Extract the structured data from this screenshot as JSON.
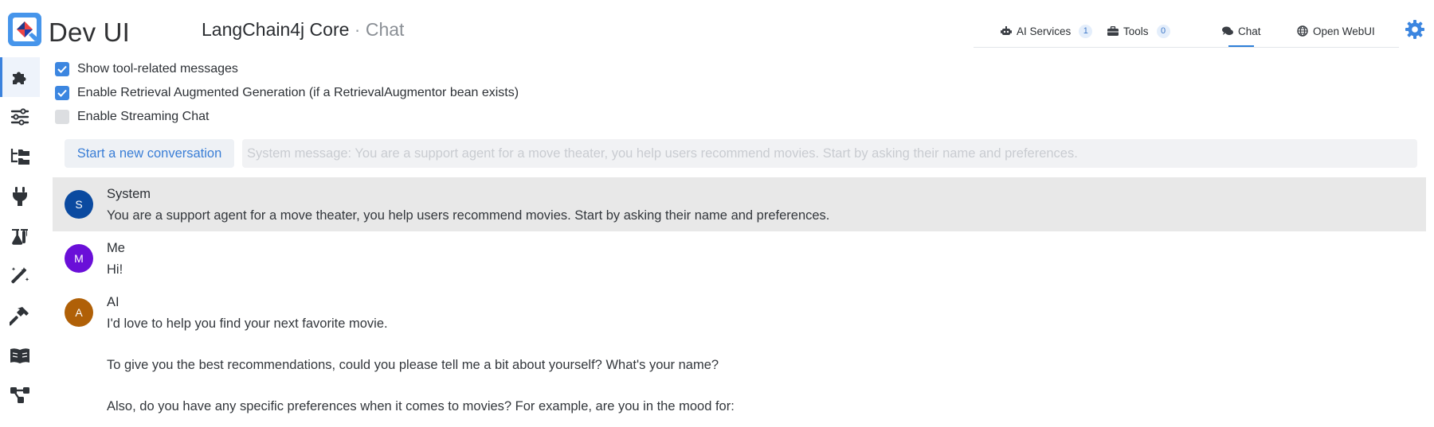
{
  "app": {
    "title": "Dev UI"
  },
  "extension": {
    "name": "LangChain4j Core",
    "separator": "·",
    "page": "Chat"
  },
  "tabs": [
    {
      "label": "AI Services",
      "icon": "robot-icon",
      "badge": "1"
    },
    {
      "label": "Tools",
      "icon": "toolbox-icon",
      "badge": "0"
    },
    {
      "label": "Chat",
      "icon": "comments-icon",
      "active": true
    },
    {
      "label": "Open WebUI",
      "icon": "globe-icon"
    }
  ],
  "sidebar": {
    "items": [
      {
        "icon": "puzzle-icon",
        "active": true
      },
      {
        "icon": "sliders-icon"
      },
      {
        "icon": "folder-tree-icon"
      },
      {
        "icon": "plug-icon"
      },
      {
        "icon": "flask-icon"
      },
      {
        "icon": "magic-wand-icon"
      },
      {
        "icon": "hammer-icon"
      },
      {
        "icon": "book-icon"
      },
      {
        "icon": "diagram-icon"
      }
    ]
  },
  "options": [
    {
      "label": "Show tool-related messages",
      "checked": true
    },
    {
      "label": "Enable Retrieval Augmented Generation (if a RetrievalAugmentor bean exists)",
      "checked": true
    },
    {
      "label": "Enable Streaming Chat",
      "checked": false
    }
  ],
  "conversation": {
    "new_button": "Start a new conversation",
    "system_placeholder": "System message: You are a support agent for a move theater, you help users recommend movies. Start by asking their name and preferences."
  },
  "messages": [
    {
      "initial": "S",
      "sender": "System",
      "color": "#0b4aa0",
      "lines": [
        "You are a support agent for a move theater, you help users recommend movies. Start by asking their name and preferences."
      ]
    },
    {
      "initial": "M",
      "sender": "Me",
      "color": "#6a0fd8",
      "lines": [
        "Hi!"
      ]
    },
    {
      "initial": "A",
      "sender": "AI",
      "color": "#b06007",
      "lines": [
        "I'd love to help you find your next favorite movie.",
        "To give you the best recommendations, could you please tell me a bit about yourself? What's your name?",
        "Also, do you have any specific preferences when it comes to movies? For example, are you in the mood for:"
      ]
    }
  ],
  "colors": {
    "accent": "#3c86e0",
    "system_bg": "#e8e8e8",
    "logo_blue": "#4695eb",
    "logo_red": "#ef4444"
  }
}
